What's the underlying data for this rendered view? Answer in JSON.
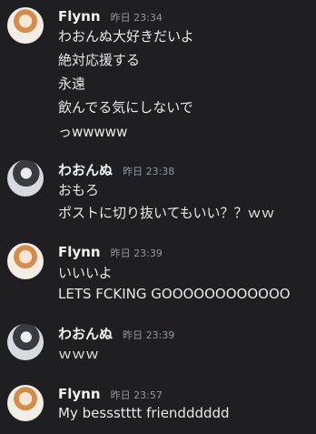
{
  "messages": [
    {
      "author": "Flynn",
      "time": "昨日 23:34",
      "lines": [
        "わおんぬ大好きだいよ",
        "絶対応援する",
        "永遠",
        "飲んでる気にしないで",
        "っwwwww"
      ]
    },
    {
      "author": "わおんぬ",
      "time": "昨日 23:38",
      "lines": [
        "おもろ",
        "ポストに切り抜いてもいい？？ｗｗ"
      ]
    },
    {
      "author": "Flynn",
      "time": "昨日 23:39",
      "lines": [
        "いいいよ",
        "LETS FCKING GOOOOOOOOOOOO"
      ]
    },
    {
      "author": "わおんぬ",
      "time": "昨日 23:39",
      "lines": [
        "ｗｗｗ"
      ]
    },
    {
      "author": "Flynn",
      "time": "昨日 23:57",
      "lines": [
        "My bessstttt friendddddd"
      ]
    }
  ]
}
